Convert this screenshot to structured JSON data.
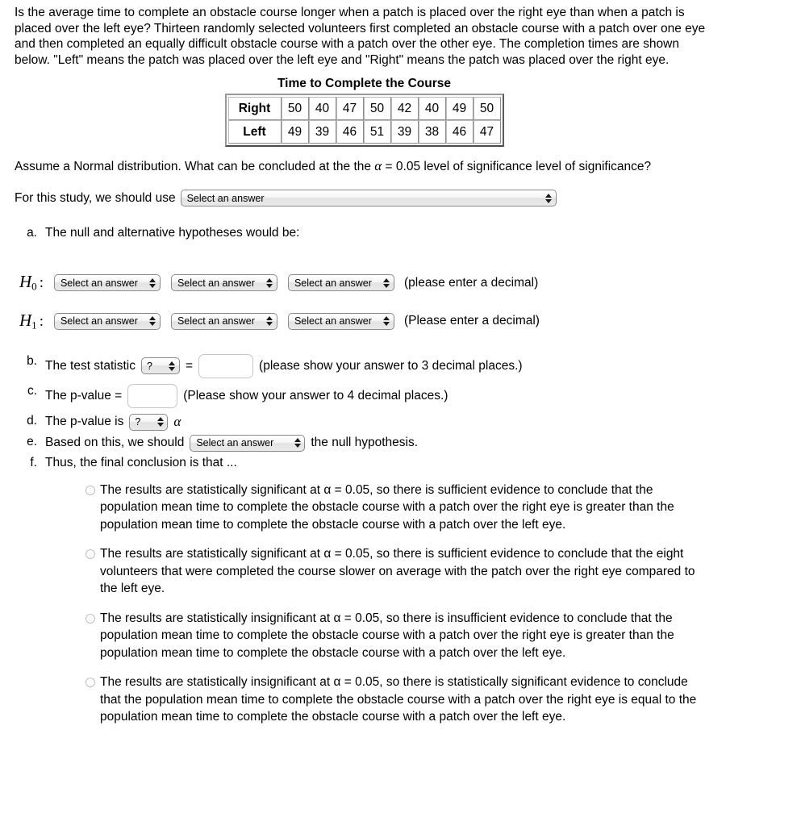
{
  "intro": {
    "paragraph": "Is the average time to complete an obstacle course longer when a patch is placed over the right eye than when a patch is placed over the left eye? Thirteen randomly selected volunteers first completed an obstacle course with a patch over one eye and then completed an equally difficult obstacle course with a patch over the other eye. The completion times are shown below. \"Left\" means the patch was placed over the left eye and \"Right\" means the patch was placed over the right eye."
  },
  "data_table": {
    "title": "Time to Complete the Course",
    "rows": [
      {
        "label": "Right",
        "values": [
          "50",
          "40",
          "47",
          "50",
          "42",
          "40",
          "49",
          "50"
        ]
      },
      {
        "label": "Left",
        "values": [
          "49",
          "39",
          "46",
          "51",
          "39",
          "38",
          "46",
          "47"
        ]
      }
    ]
  },
  "assume": {
    "text_before_alpha": "Assume a Normal distribution.  What can be concluded at the the ",
    "alpha": "α",
    "text_after_alpha": " = 0.05 level of significance level of significance?"
  },
  "study_line": {
    "label": "For this study, we should use",
    "select_value": "Select an answer"
  },
  "parts": {
    "a": {
      "marker": "a.",
      "text": "The null and alternative hypotheses would be:",
      "h0_label": "H",
      "h0_sub": "0",
      "h1_label": "H",
      "h1_sub": "1",
      "colon": ":",
      "select_value": "Select an answer",
      "h0_trailing": "(please enter a decimal)",
      "h1_trailing": "(Please enter a decimal)"
    },
    "b": {
      "marker": "b.",
      "text_before": "The test statistic",
      "select_value": "?",
      "equals": "=",
      "input_value": "",
      "text_after": "(please show your answer to 3 decimal places.)"
    },
    "c": {
      "marker": "c.",
      "text_before": "The p-value =",
      "input_value": "",
      "text_after": "(Please show your answer to 4 decimal places.)"
    },
    "d": {
      "marker": "d.",
      "text_before": "The p-value is",
      "select_value": "?",
      "alpha": "α"
    },
    "e": {
      "marker": "e.",
      "text_before": "Based on this, we should",
      "select_value": "Select an answer",
      "text_after": "the null hypothesis."
    },
    "f": {
      "marker": "f.",
      "text": "Thus, the final conclusion is that ...",
      "options": [
        "The results are statistically significant at α = 0.05, so there is sufficient evidence to conclude that the population mean time to complete the obstacle course with a patch over the right eye is greater than the population mean time to complete the obstacle course with a patch over the left eye.",
        "The results are statistically significant at α = 0.05, so there is sufficient evidence to conclude that the eight volunteers that were completed the course slower on average with the patch over the right eye compared to the left eye.",
        "The results are statistically insignificant at α = 0.05, so there is insufficient evidence to conclude that the population mean time to complete the obstacle course with a patch over the right eye is greater than the population mean time to complete the obstacle course with a patch over the left eye.",
        "The results are statistically insignificant at α = 0.05, so there is statistically significant evidence to conclude that the population mean time to complete the obstacle course with a patch over the right eye is equal to the population mean time to complete the obstacle course with a patch over the left eye."
      ]
    }
  }
}
